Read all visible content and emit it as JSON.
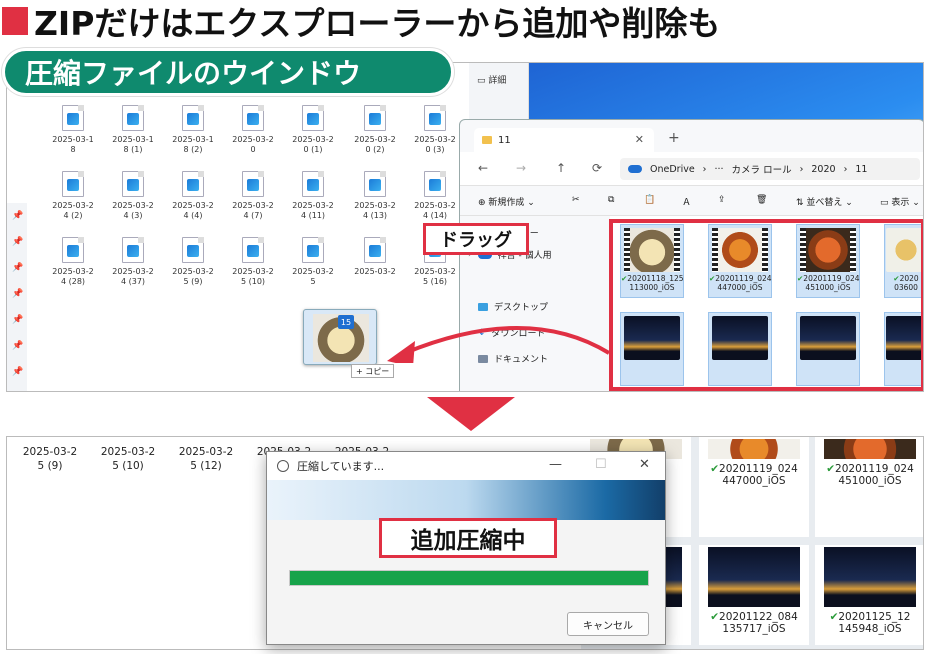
{
  "headline": "ZIPだけはエクスプローラーから追加や削除も",
  "section_tag": "圧縮ファイルのウインドウ",
  "detail_label": "詳細",
  "top_files": [
    [
      "2025-03-1",
      "8"
    ],
    [
      "2025-03-1",
      "8 (1)"
    ],
    [
      "2025-03-1",
      "8 (2)"
    ],
    [
      "2025-03-2",
      "0"
    ],
    [
      "2025-03-2",
      "0 (1)"
    ],
    [
      "2025-03-2",
      "0 (2)"
    ],
    [
      "2025-03-2",
      "0 (3)"
    ],
    [
      "2025-03-2",
      "4 (2)"
    ],
    [
      "2025-03-2",
      "4 (3)"
    ],
    [
      "2025-03-2",
      "4 (4)"
    ],
    [
      "2025-03-2",
      "4 (7)"
    ],
    [
      "2025-03-2",
      "4 (11)"
    ],
    [
      "2025-03-2",
      "4 (13)"
    ],
    [
      "2025-03-2",
      "4 (14)"
    ],
    [
      "2025-03-2",
      "4 (28)"
    ],
    [
      "2025-03-2",
      "4 (37)"
    ],
    [
      "2025-03-2",
      "5 (9)"
    ],
    [
      "2025-03-2",
      "5 (10)"
    ],
    [
      "2025-03-2",
      "5"
    ],
    [
      "2025-03-2",
      ""
    ],
    [
      "2025-03-2",
      "5 (16)"
    ]
  ],
  "explorer": {
    "tab_title": "11",
    "tab_close": "✕",
    "new_tab": "+",
    "nav": {
      "back": "←",
      "forward": "→",
      "up": "↑",
      "refresh": "⟳"
    },
    "address": [
      "OneDrive",
      "›",
      "···",
      "カメラ ロール",
      "›",
      "2020",
      "›",
      "11"
    ],
    "toolbar": {
      "new": "新規作成",
      "sort": "並べ替え",
      "view": "表示"
    },
    "sidebar": [
      {
        "label": "イヤラリー"
      },
      {
        "label": "祥吾 - 個人用"
      },
      {
        "label": "デスクトップ"
      },
      {
        "label": "ダウンロード"
      },
      {
        "label": "ドキュメント"
      }
    ],
    "thumbnails": [
      {
        "line1": "20201118_125",
        "line2": "113000_iOS"
      },
      {
        "line1": "20201119_024",
        "line2": "447000_iOS"
      },
      {
        "line1": "20201119_024",
        "line2": "451000_iOS"
      },
      {
        "line1": "2020",
        "line2": "03600"
      }
    ]
  },
  "drag_label": "ドラッグ",
  "drag_badge": "15",
  "copy_tip": "+ コピー",
  "bottom_files": [
    [
      "2025-03-2",
      "5 (9)"
    ],
    [
      "2025-03-2",
      "5 (10)"
    ],
    [
      "2025-03-2",
      "5 (12)"
    ],
    [
      "2025-03-2",
      ""
    ],
    [
      "2025-03-2",
      ""
    ]
  ],
  "bottom_thumbs": [
    {
      "line1": "18_125",
      "line2": "iOS"
    },
    {
      "line1": "20201119_024",
      "line2": "447000_iOS"
    },
    {
      "line1": "20201119_024",
      "line2": "451000_iOS"
    },
    {
      "line1": "22_084",
      "line2": "iOS"
    },
    {
      "line1": "20201122_084",
      "line2": "135717_iOS"
    },
    {
      "line1": "20201125_12",
      "line2": "145948_iOS"
    }
  ],
  "dialog": {
    "title": "圧縮しています...",
    "minimize": "—",
    "maximize": "☐",
    "close": "✕",
    "status_label": "追加圧縮中",
    "progress": 1.0,
    "cancel": "キャンセル"
  },
  "colors": {
    "accent_red": "#e03043",
    "tag_green": "#0f8a6e",
    "progress_green": "#17a34a"
  }
}
